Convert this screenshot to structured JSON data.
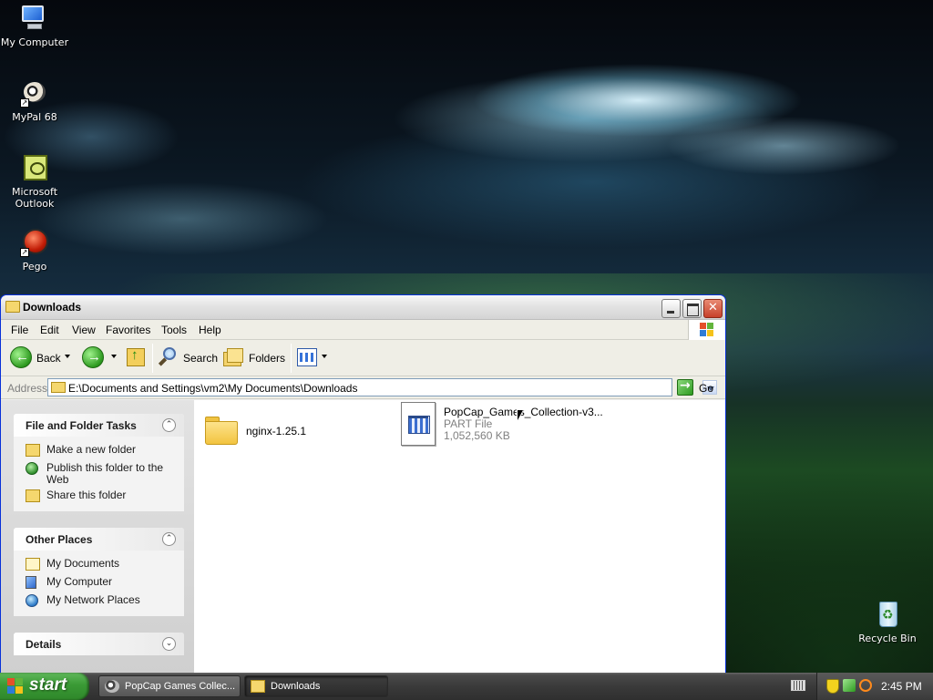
{
  "desktop": {
    "icons": [
      {
        "label": "My Computer",
        "icon": "my-computer-icon"
      },
      {
        "label": "MyPal 68",
        "icon": "mypal-icon"
      },
      {
        "label": "Microsoft Outlook",
        "icon": "outlook-icon"
      },
      {
        "label": "Pego",
        "icon": "pego-icon"
      },
      {
        "label": "Recycle Bin",
        "icon": "recycle-bin-icon"
      }
    ]
  },
  "window": {
    "title": "Downloads",
    "menu": [
      "File",
      "Edit",
      "View",
      "Favorites",
      "Tools",
      "Help"
    ],
    "toolbar": {
      "back": "Back",
      "search": "Search",
      "folders": "Folders"
    },
    "address": {
      "label": "Address",
      "value": "E:\\Documents and Settings\\vm2\\My Documents\\Downloads",
      "go": "Go"
    },
    "tasks": {
      "file_folder_title": "File and Folder Tasks",
      "file_folder_items": [
        "Make a new folder",
        "Publish this folder to the Web",
        "Share this folder"
      ],
      "other_places_title": "Other Places",
      "other_places_items": [
        "My Documents",
        "My Computer",
        "My Network Places"
      ],
      "details_title": "Details"
    },
    "files": [
      {
        "name": "nginx-1.25.1",
        "type": "",
        "size": ""
      },
      {
        "name": "PopCap_Games_Collection-v3...",
        "type": "PART File",
        "size": "1,052,560 KB"
      }
    ]
  },
  "taskbar": {
    "start": "start",
    "buttons": [
      "PopCap Games Collec...",
      "Downloads"
    ],
    "clock": "2:45 PM"
  },
  "colors": {
    "accent_green": "#3a9a35",
    "window_frame": "#e3e3e3",
    "close_red": "#c7402a"
  }
}
